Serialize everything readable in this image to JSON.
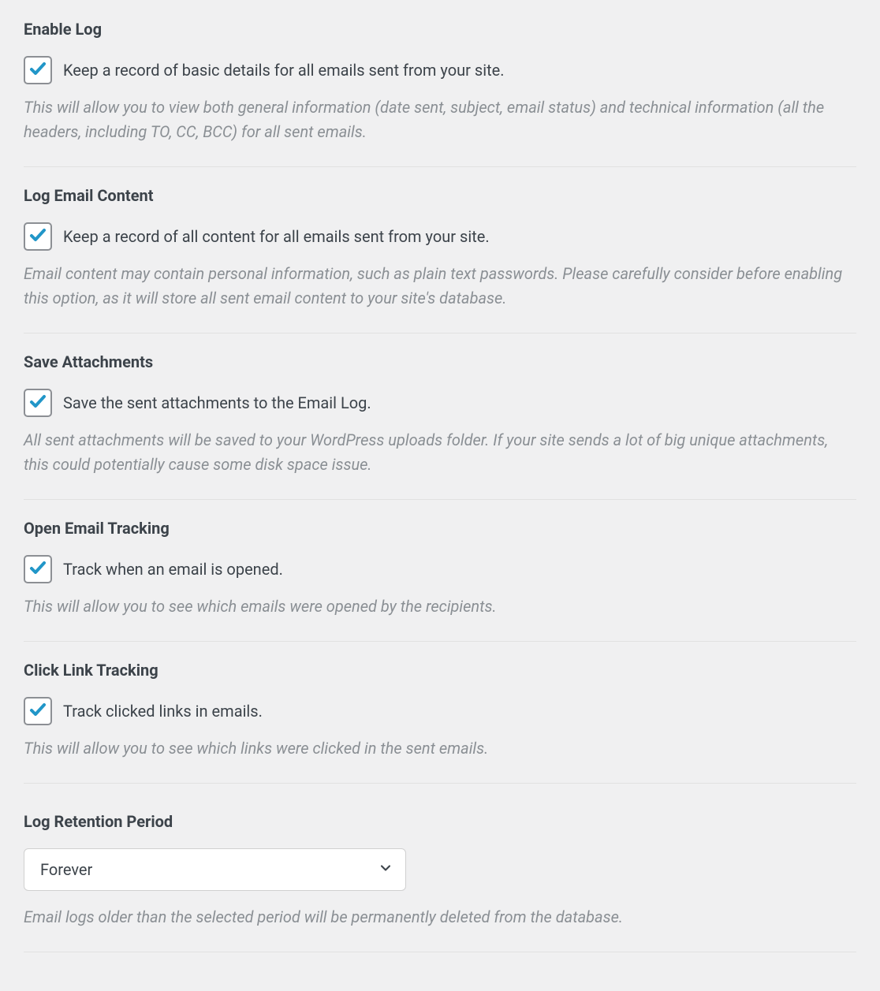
{
  "sections": {
    "enable_log": {
      "title": "Enable Log",
      "checkbox_label": "Keep a record of basic details for all emails sent from your site.",
      "description": "This will allow you to view both general information (date sent, subject, email status) and technical information (all the headers, including TO, CC, BCC) for all sent emails.",
      "checked": true
    },
    "log_email_content": {
      "title": "Log Email Content",
      "checkbox_label": "Keep a record of all content for all emails sent from your site.",
      "description": "Email content may contain personal information, such as plain text passwords. Please carefully consider before enabling this option, as it will store all sent email content to your site's database.",
      "checked": true
    },
    "save_attachments": {
      "title": "Save Attachments",
      "checkbox_label": "Save the sent attachments to the Email Log.",
      "description": "All sent attachments will be saved to your WordPress uploads folder. If your site sends a lot of big unique attachments, this could potentially cause some disk space issue.",
      "checked": true
    },
    "open_email_tracking": {
      "title": "Open Email Tracking",
      "checkbox_label": "Track when an email is opened.",
      "description": "This will allow you to see which emails were opened by the recipients.",
      "checked": true
    },
    "click_link_tracking": {
      "title": "Click Link Tracking",
      "checkbox_label": "Track clicked links in emails.",
      "description": "This will allow you to see which links were clicked in the sent emails.",
      "checked": true
    },
    "log_retention_period": {
      "title": "Log Retention Period",
      "selected": "Forever",
      "description": "Email logs older than the selected period will be permanently deleted from the database."
    }
  },
  "colors": {
    "check_blue": "#2196c8",
    "text_dark": "#3c434a",
    "text_muted": "#8a8f94"
  }
}
